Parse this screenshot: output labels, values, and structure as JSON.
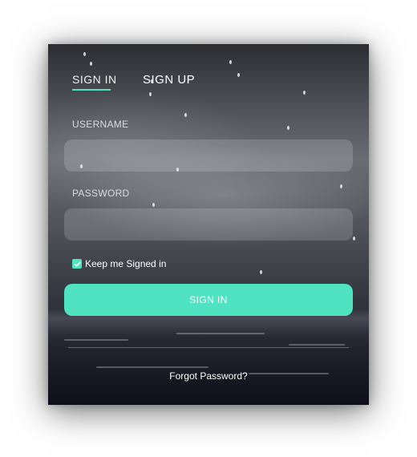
{
  "tabs": {
    "signin": "SIGN IN",
    "signup": "SIGN UP"
  },
  "form": {
    "username_label": "USERNAME",
    "username_value": "",
    "password_label": "PASSWORD",
    "password_value": "",
    "remember_label": "Keep me Signed in",
    "remember_checked": true,
    "submit_label": "SIGN IN",
    "forgot_label": "Forgot Password?"
  },
  "colors": {
    "accent": "#50e3c2",
    "text": "#ffffff"
  },
  "icons": {
    "checkbox": "check-icon"
  }
}
